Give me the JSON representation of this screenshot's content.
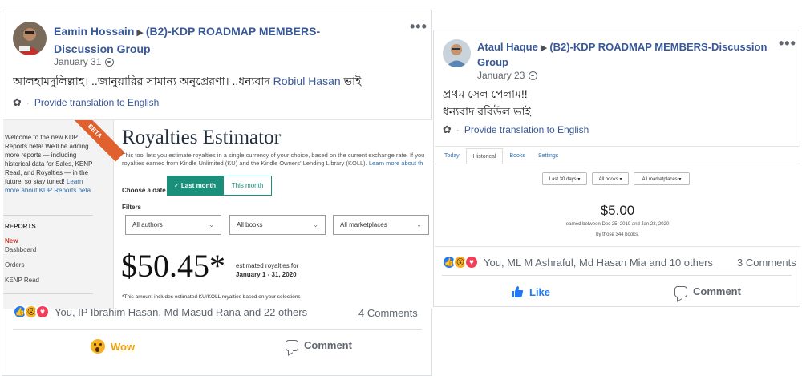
{
  "post1": {
    "author": "Eamin Hossain",
    "group": "(B2)-KDP ROADMAP MEMBERS-Discussion Group",
    "date": "January 31",
    "text": "আলহামদুলিল্লাহ। ..জানুয়ারির সামান্য অনুপ্রেরণা। ..ধন্যবাদ",
    "mention": "Robiul Hasan",
    "text_end": "ভাই",
    "translate": "Provide translation to English",
    "reactions_text": "You, IP Ibrahim Hasan, Md Masud Rana and 22 others",
    "comments_count": "4 Comments",
    "action_reaction": "Wow",
    "action_comment": "Comment",
    "screenshot": {
      "beta": "BETA",
      "welcome": "Welcome to the new KDP Reports beta! We'll be adding more reports — including historical data for Sales, KENP Read, and Royalties — in the future, so stay tuned!",
      "learn_more": "Learn more about KDP Reports beta",
      "reports_label": "REPORTS",
      "new_label": "New",
      "nav": [
        "Dashboard",
        "Orders",
        "KENP Read"
      ],
      "title": "Royalties Estimator",
      "desc_line1": "This tool lets you estimate royalties in a single currency of your choice, based on the current exchange rate. If you",
      "desc_line2": "royalties earned from Kindle Unlimited (KU) and the Kindle Owners' Lending Library (KOLL).",
      "desc_link": "Learn more about th",
      "choose_date": "Choose a date",
      "seg_on": "✓ Last month",
      "seg_off": "This month",
      "filters_label": "Filters",
      "dropdowns": [
        "All authors",
        "All books",
        "All marketplaces"
      ],
      "amount": "$50.45*",
      "est_line1": "estimated royalties for",
      "est_line2": "January 1 - 31, 2020",
      "note": "*This amount includes estimated KU/KOLL royalties based on your selections"
    }
  },
  "post2": {
    "author": "Ataul Haque",
    "group": "(B2)-KDP ROADMAP MEMBERS-Discussion Group",
    "date": "January 23",
    "line1": "প্রথম সেল পেলাম!!",
    "line2": "ধন্যবাদ রবিউল ভাই",
    "translate": "Provide translation to English",
    "reactions_text": "You, ML M Ashraful, Md Hasan Mia and 10 others",
    "comments_count": "3 Comments",
    "action_like": "Like",
    "action_comment": "Comment",
    "screenshot": {
      "tabs": [
        "Today",
        "Historical",
        "Books",
        "Settings"
      ],
      "dropdowns": [
        "Last 30 days ▾",
        "All books ▾",
        "All marketplaces ▾"
      ],
      "amount": "$5.00",
      "sub1": "earned between Dec 25, 2019 and Jan 23, 2020",
      "sub2": "by those 344 books."
    }
  }
}
